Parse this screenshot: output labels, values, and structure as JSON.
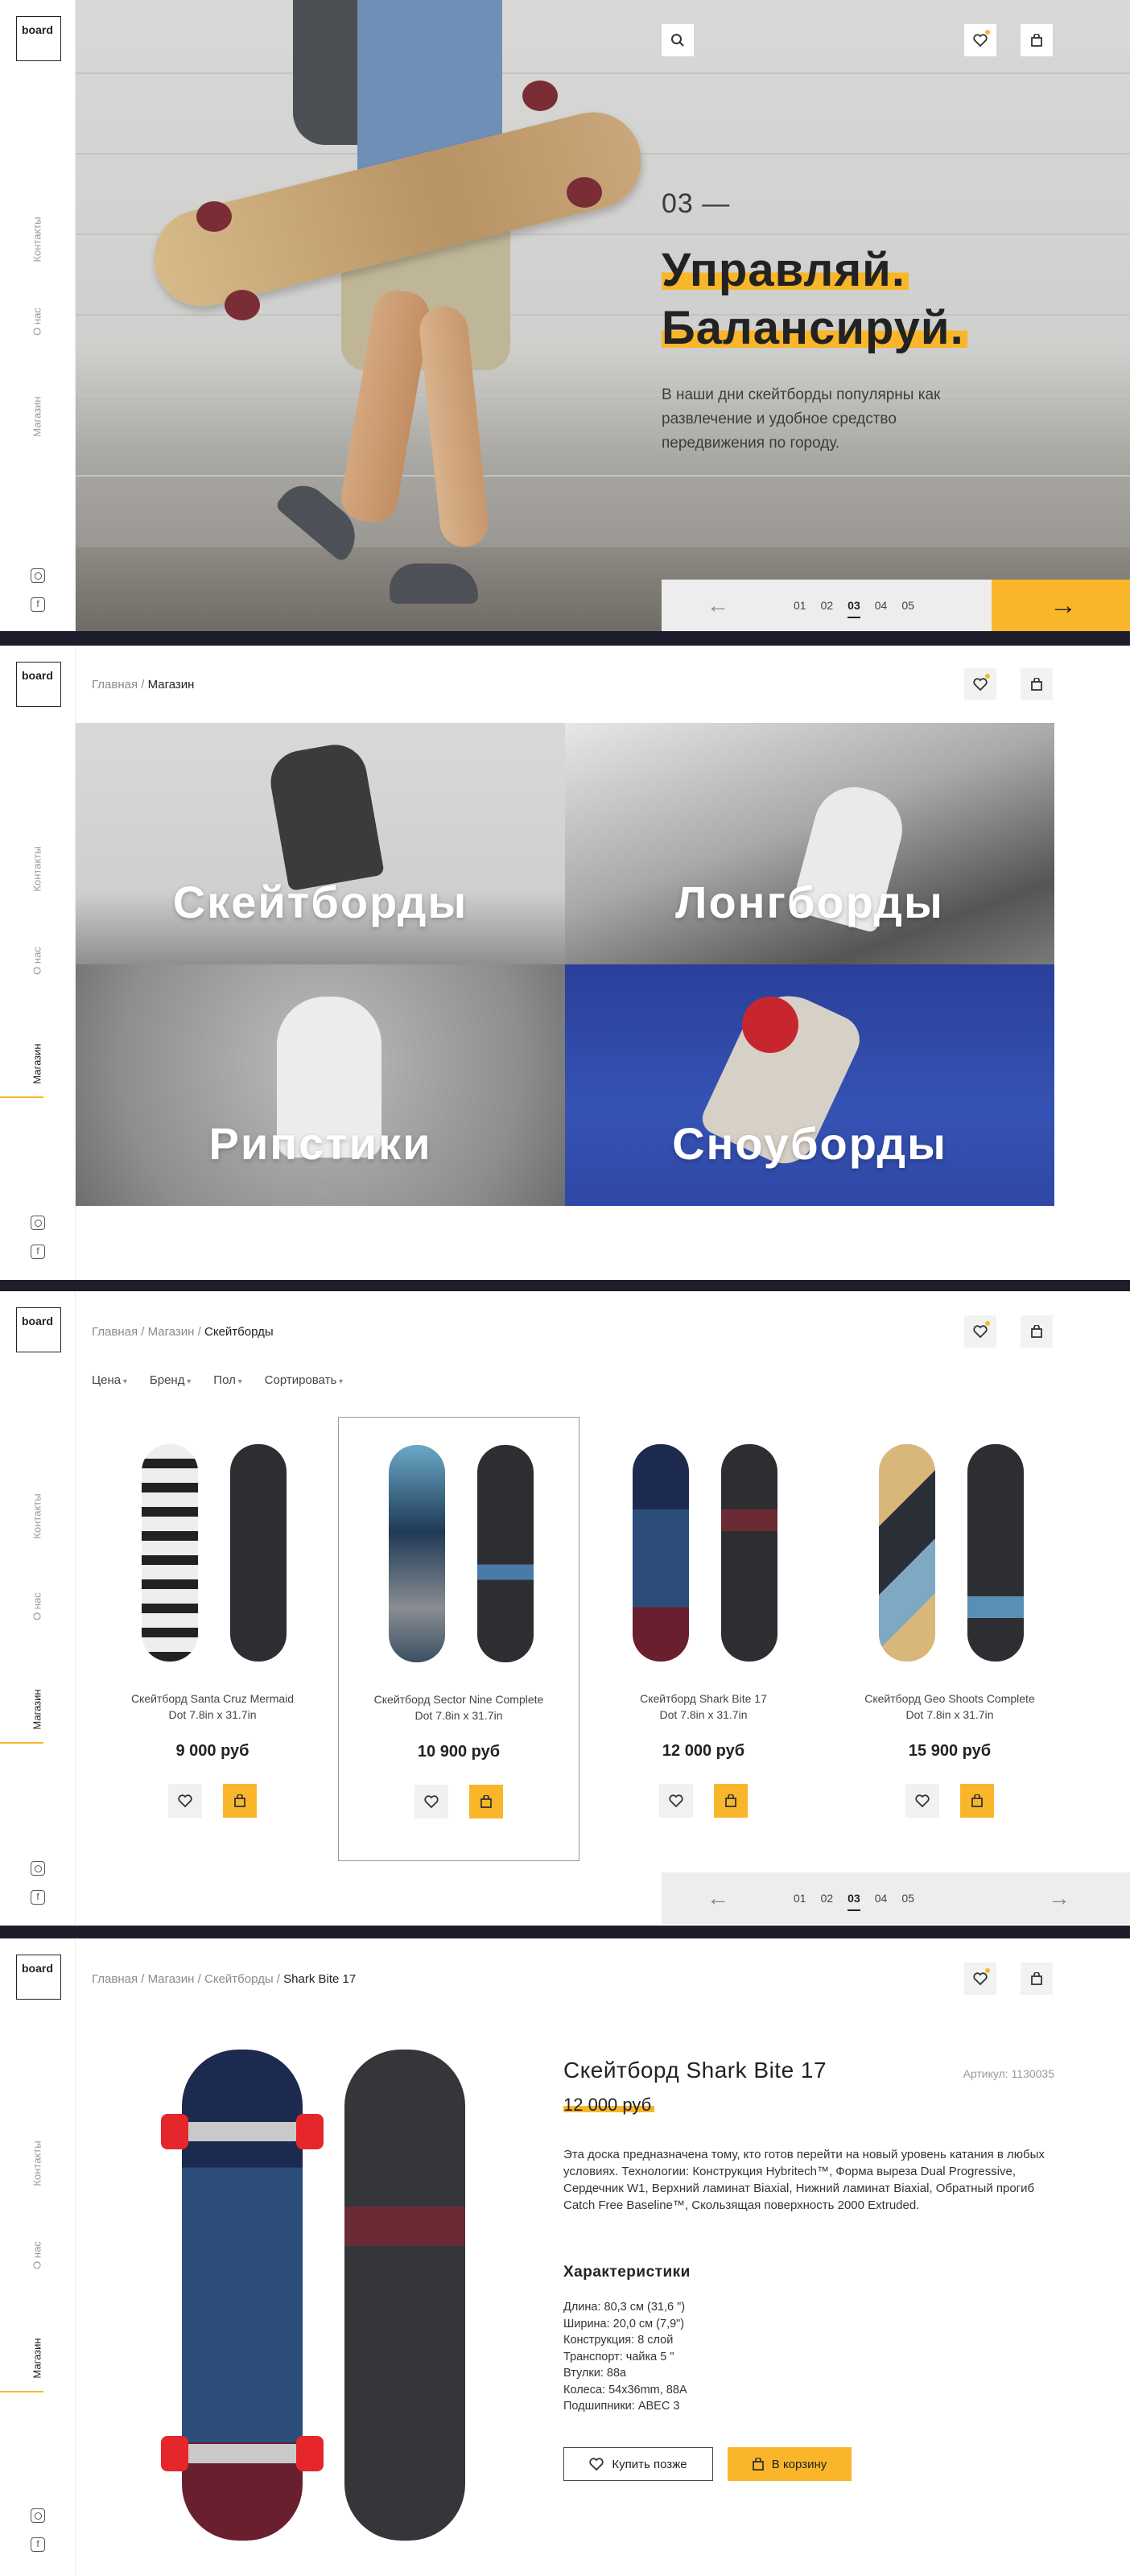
{
  "brand": "board",
  "nav": [
    "Контакты",
    "О нас",
    "Магазин"
  ],
  "hero": {
    "slide_number": "03 —",
    "title_line1": "Управляй.",
    "title_line2": "Балансируй.",
    "text": "В наши дни скейтборды популярны как развлечение и удобное средство передвижения по городу.",
    "pages": [
      "01",
      "02",
      "03",
      "04",
      "05"
    ],
    "current_page": "03"
  },
  "catalog": {
    "breadcrumb_home": "Главная",
    "breadcrumb_shop": "Магазин",
    "categories": [
      "Скейтборды",
      "Лонгборды",
      "Рипстики",
      "Сноуборды"
    ]
  },
  "listing": {
    "breadcrumb": [
      "Главная",
      "Магазин",
      "Скейтборды"
    ],
    "filters": [
      "Цена",
      "Бренд",
      "Пол",
      "Сортировать"
    ],
    "products": [
      {
        "name": "Скейтборд Santa Cruz Mermaid",
        "size": "Dot 7.8in x 31.7in",
        "price": "9 000 руб"
      },
      {
        "name": "Скейтборд Sector Nine Complete",
        "size": "Dot 7.8in x 31.7in",
        "price": "10 900 руб"
      },
      {
        "name": "Скейтборд Shark Bite 17",
        "size": "Dot 7.8in x 31.7in",
        "price": "12 000 руб"
      },
      {
        "name": "Скейтборд Geo Shoots Complete",
        "size": "Dot 7.8in x 31.7in",
        "price": "15 900 руб"
      }
    ],
    "pages": [
      "01",
      "02",
      "03",
      "04",
      "05"
    ]
  },
  "detail": {
    "breadcrumb": [
      "Главная",
      "Магазин",
      "Скейтборды",
      "Shark Bite 17"
    ],
    "title": "Скейтборд Shark Bite 17",
    "article": "Артикул: 1130035",
    "price": "12 000 руб",
    "description": "Эта доска предназначена тому, кто готов перейти на новый уровень катания в любых условиях. Технологии: Конструкция Hybritech™, Форма выреза Dual Progressive, Сердечник W1, Верхний ламинат Biaxial, Нижний ламинат Biaxial, Обратный прогиб Catch Free Baseline™, Скользящая поверхность 2000 Extruded.",
    "specs_title": "Характеристики",
    "specs": [
      "Длина: 80,3 см (31,6 \")",
      "Ширина: 20,0 см (7,9\")",
      "Конструкция: 8 слой",
      "Транспорт: чайка 5 \"",
      "Втулки: 88a",
      "Колеса: 54x36mm, 88A",
      "Подшипники: ABEC 3"
    ],
    "later_label": "Купить позже",
    "cart_label": "В корзину"
  },
  "colors": {
    "accent": "#f9b62a",
    "dark": "#1d1d2b"
  }
}
